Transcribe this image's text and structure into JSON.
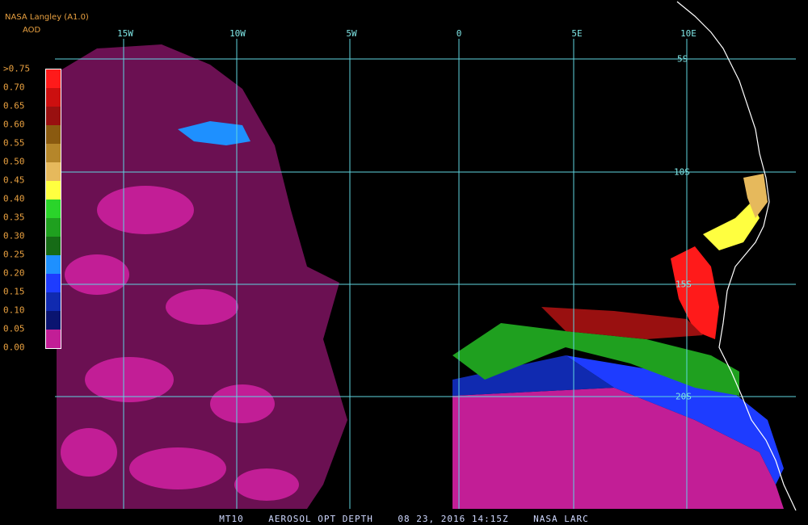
{
  "header": {
    "title": "NASA Langley (A1.0)",
    "unit": "AOD"
  },
  "footer": {
    "product": "MT10",
    "parameter": "AEROSOL OPT DEPTH",
    "datetime": "08 23, 2016 14:15Z",
    "source": "NASA LARC"
  },
  "longitude_labels": [
    "15W",
    "10W",
    "5W",
    "0",
    "5E",
    "10E"
  ],
  "latitude_labels": [
    "5S",
    "10S",
    "15S",
    "20S"
  ],
  "legend": {
    "tick_labels": [
      ">0.75",
      "0.70",
      "0.65",
      "0.60",
      "0.55",
      "0.50",
      "0.45",
      "0.40",
      "0.35",
      "0.30",
      "0.25",
      "0.20",
      "0.15",
      "0.10",
      "0.05",
      "0.00"
    ],
    "colors": [
      "#ff1a1a",
      "#cc0f0f",
      "#991010",
      "#8a5a10",
      "#b5862a",
      "#e6b95c",
      "#ffff40",
      "#2ad42a",
      "#1fa01f",
      "#166b16",
      "#1e90ff",
      "#1e3cff",
      "#102ab0",
      "#0a1470",
      "#c21e96"
    ]
  },
  "colors": {
    "grid": "#5fd6e0",
    "coastline": "#ffffff",
    "background": "#000000"
  }
}
